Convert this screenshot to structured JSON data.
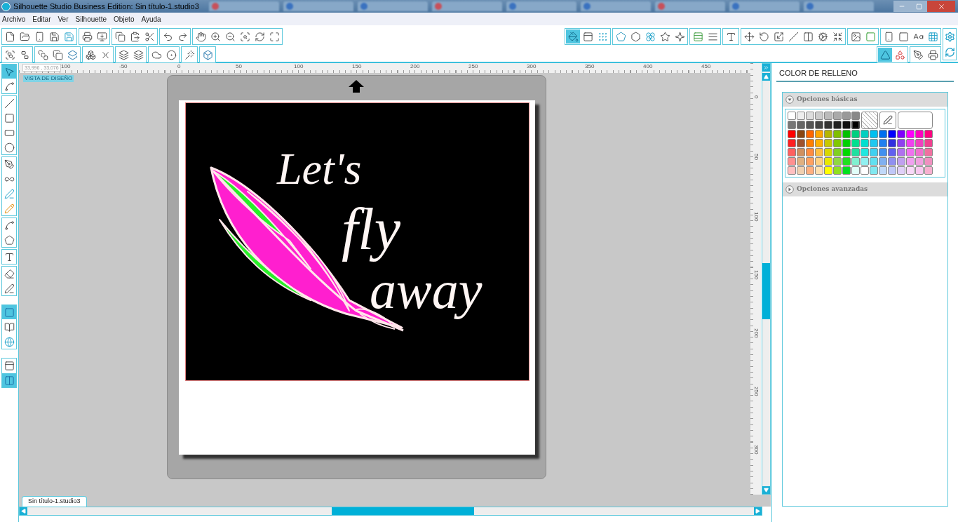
{
  "title_bar": {
    "title": "Silhouette Studio Business Edition: Sin título-1.studio3"
  },
  "menu": [
    "Archivo",
    "Editar",
    "Ver",
    "Silhouette",
    "Objeto",
    "Ayuda"
  ],
  "toolbar_top_left": [
    [
      {
        "selected": false
      },
      {
        "selected": false
      },
      {
        "selected": false
      },
      {
        "selected": false
      },
      {
        "selected": false
      }
    ],
    [
      {
        "selected": false
      },
      {
        "selected": false
      }
    ],
    [
      {
        "selected": false
      },
      {
        "selected": false
      },
      {
        "selected": false
      }
    ],
    [
      {
        "selected": false
      },
      {
        "selected": false
      }
    ],
    [
      {
        "selected": false
      },
      {
        "selected": false
      },
      {
        "selected": false
      },
      {
        "selected": false
      },
      {
        "selected": false
      },
      {
        "selected": false
      }
    ]
  ],
  "toolbar_bottom_left": [
    [
      {
        "selected": false
      },
      {
        "selected": false
      }
    ],
    [
      {
        "selected": false
      },
      {
        "selected": false
      },
      {
        "selected": false
      }
    ],
    [
      {
        "selected": false
      },
      {
        "selected": false
      }
    ],
    [
      {
        "selected": false
      },
      {
        "selected": false
      }
    ],
    [
      {
        "selected": false
      },
      {
        "selected": false
      }
    ],
    [
      {
        "selected": false
      }
    ],
    [
      {
        "selected": false
      }
    ]
  ],
  "toolbar_top_right": [
    [
      {
        "selected": true
      },
      {
        "selected": false
      },
      {
        "selected": false
      }
    ],
    [
      {
        "selected": false
      },
      {
        "selected": false
      },
      {
        "selected": false
      },
      {
        "selected": false
      },
      {
        "selected": false
      }
    ],
    [
      {
        "selected": false
      },
      {
        "selected": false
      }
    ],
    [
      {
        "selected": false
      }
    ],
    [
      {
        "selected": false
      },
      {
        "selected": false
      },
      {
        "selected": false
      },
      {
        "selected": false
      },
      {
        "selected": false
      },
      {
        "selected": false
      },
      {
        "selected": false
      }
    ],
    [
      {
        "selected": false
      },
      {
        "selected": false
      }
    ],
    [
      {
        "selected": false
      },
      {
        "selected": false
      },
      {
        "selected": false
      },
      {
        "selected": false
      }
    ]
  ],
  "toolbar_bottom_right": [
    [
      {
        "selected": true
      },
      {
        "selected": false
      }
    ],
    [
      {
        "selected": false
      },
      {
        "selected": false
      }
    ]
  ],
  "side_tools": [
    [
      {
        "selected": true
      },
      {
        "selected": false
      }
    ],
    [
      {
        "selected": false
      },
      {
        "selected": false
      },
      {
        "selected": false
      },
      {
        "selected": false
      }
    ],
    [
      {
        "selected": false
      },
      {
        "selected": false
      },
      {
        "selected": false
      },
      {
        "selected": false
      }
    ],
    [
      {
        "selected": false
      },
      {
        "selected": false
      }
    ],
    [
      {
        "selected": false
      }
    ],
    [
      {
        "selected": false
      },
      {
        "selected": false
      }
    ],
    [
      {
        "selected": true
      },
      {
        "selected": false
      },
      {
        "selected": false
      }
    ],
    [
      {
        "selected": false
      },
      {
        "selected": true
      }
    ]
  ],
  "ruler": {
    "coordinates": "33,996 , 33,076",
    "x_labels": [
      "100",
      "-50",
      "0",
      "50",
      "100",
      "150",
      "200",
      "250",
      "300",
      "350",
      "400",
      "450"
    ],
    "y_labels": [
      "0",
      "50",
      "100",
      "150",
      "200",
      "250",
      "300"
    ]
  },
  "view_badge": "VISTA DE DISEÑO",
  "design": {
    "lines": [
      "Let's",
      "fly",
      "away"
    ]
  },
  "document_tab": {
    "label": "Sin título-1.studio3"
  },
  "panel": {
    "title": "COLOR DE RELLENO",
    "sections": [
      {
        "label": "Opciones básicas",
        "expanded": true
      },
      {
        "label": "Opciones avanzadas",
        "expanded": false
      }
    ],
    "grays": [
      [
        {
          "color": "#ffffff",
          "selected": false
        },
        {
          "color": "#eeeeee",
          "selected": false
        },
        {
          "color": "#dddddd",
          "selected": false
        },
        {
          "color": "#cccccc",
          "selected": false
        },
        {
          "color": "#bbbbbb",
          "selected": false
        },
        {
          "color": "#aaaaaa",
          "selected": false
        },
        {
          "color": "#999999",
          "selected": false
        },
        {
          "color": "#888888",
          "selected": false
        }
      ],
      [
        {
          "color": "#777777",
          "selected": false
        },
        {
          "color": "#666666",
          "selected": false
        },
        {
          "color": "#555555",
          "selected": false
        },
        {
          "color": "#444444",
          "selected": false
        },
        {
          "color": "#333333",
          "selected": false
        },
        {
          "color": "#222222",
          "selected": false
        },
        {
          "color": "#111111",
          "selected": false
        },
        {
          "color": "#000000",
          "selected": true
        }
      ]
    ],
    "colors": [
      [
        {
          "color": "#ff0000"
        },
        {
          "color": "#8b4513"
        },
        {
          "color": "#ff6600"
        },
        {
          "color": "#ffa500"
        },
        {
          "color": "#b5b500"
        },
        {
          "color": "#7fbf00"
        },
        {
          "color": "#00c000"
        },
        {
          "color": "#00d080"
        },
        {
          "color": "#00d0c0"
        },
        {
          "color": "#00c0f0"
        },
        {
          "color": "#0070f0"
        },
        {
          "color": "#0000ff"
        },
        {
          "color": "#8000ff"
        },
        {
          "color": "#ff00ff"
        },
        {
          "color": "#ff00c0"
        },
        {
          "color": "#ff0080"
        }
      ],
      [
        {
          "color": "#ff2020"
        },
        {
          "color": "#a0522d"
        },
        {
          "color": "#ff7f00"
        },
        {
          "color": "#ffb000"
        },
        {
          "color": "#c8c800"
        },
        {
          "color": "#80c800"
        },
        {
          "color": "#00d000"
        },
        {
          "color": "#00e090"
        },
        {
          "color": "#00e0d0"
        },
        {
          "color": "#20c8f0"
        },
        {
          "color": "#2080f0"
        },
        {
          "color": "#3030e0"
        },
        {
          "color": "#9040f0"
        },
        {
          "color": "#f040f0"
        },
        {
          "color": "#f040c0"
        },
        {
          "color": "#f04090"
        }
      ],
      [
        {
          "color": "#ff6060"
        },
        {
          "color": "#d09060"
        },
        {
          "color": "#ff8c40"
        },
        {
          "color": "#ffc040"
        },
        {
          "color": "#d8d800"
        },
        {
          "color": "#80d020"
        },
        {
          "color": "#00d800"
        },
        {
          "color": "#20e0a0"
        },
        {
          "color": "#20e8e0"
        },
        {
          "color": "#40d0f0"
        },
        {
          "color": "#4090f0"
        },
        {
          "color": "#6060f0"
        },
        {
          "color": "#b070f0"
        },
        {
          "color": "#f070f0"
        },
        {
          "color": "#f070d0"
        },
        {
          "color": "#f070a0"
        }
      ],
      [
        {
          "color": "#ff9090"
        },
        {
          "color": "#e0b080"
        },
        {
          "color": "#ffa060"
        },
        {
          "color": "#ffd080"
        },
        {
          "color": "#e8e800"
        },
        {
          "color": "#90d840"
        },
        {
          "color": "#20e020"
        },
        {
          "color": "#80f0d0"
        },
        {
          "color": "#90f0f0"
        },
        {
          "color": "#60e0f0"
        },
        {
          "color": "#80b0f0"
        },
        {
          "color": "#9090f0"
        },
        {
          "color": "#c0a0f0"
        },
        {
          "color": "#f0a0f0"
        },
        {
          "color": "#f0a0e0"
        },
        {
          "color": "#f090c0"
        }
      ],
      [
        {
          "color": "#ffc0c0"
        },
        {
          "color": "#f0d0b0"
        },
        {
          "color": "#ffb080"
        },
        {
          "color": "#ffe0b0"
        },
        {
          "color": "#ffff00"
        },
        {
          "color": "#90e020"
        },
        {
          "color": "#00e020"
        },
        {
          "color": "#e0fff8"
        },
        {
          "color": "#ffffff"
        },
        {
          "color": "#80e8f0"
        },
        {
          "color": "#c0d8f8"
        },
        {
          "color": "#c0c8f8"
        },
        {
          "color": "#e0d0f8"
        },
        {
          "color": "#f8d8f8"
        },
        {
          "color": "#f8c8f0"
        },
        {
          "color": "#f8b0d0"
        }
      ]
    ]
  }
}
